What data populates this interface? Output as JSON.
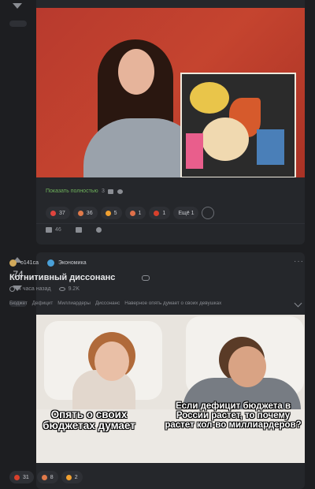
{
  "post1": {
    "show_more": "Показать полностью",
    "show_more_count": "3",
    "reactions": [
      {
        "icon": "heart-icon",
        "color": "#e0443e",
        "count": "37"
      },
      {
        "icon": "laugh-emoji-icon",
        "color": "#e07a4a",
        "count": "36"
      },
      {
        "icon": "fire-emoji-icon",
        "color": "#f0a030",
        "count": "5"
      },
      {
        "icon": "angry-emoji-icon",
        "color": "#e0704a",
        "count": "1"
      },
      {
        "icon": "tomato-emoji-icon",
        "color": "#d8402c",
        "count": "1"
      }
    ],
    "more_reactions": "Ещё 1",
    "comments_count": "46"
  },
  "post2": {
    "rating": "74",
    "author": "o141ca",
    "community": "Экономика",
    "title": "Когнитивный диссонанс",
    "time": "4 часа назад",
    "views": "9.2K",
    "tags": [
      "Бюджет",
      "Дефицит",
      "Миллиардеры",
      "Диссонанс",
      "Наверное опять думает о своих девушках"
    ],
    "meme_caption_left": "Опять о своих бюджетах думает",
    "meme_caption_right": "Если дефицит бюджета в России растет, то почему растет кол-во миллиардеров?",
    "reactions": [
      {
        "icon": "clown-emoji-icon",
        "color": "#d8402c",
        "count": "31"
      },
      {
        "icon": "laugh-emoji-icon",
        "color": "#e07a4a",
        "count": "8"
      },
      {
        "icon": "thinking-emoji-icon",
        "color": "#f0a030",
        "count": "2"
      }
    ]
  }
}
